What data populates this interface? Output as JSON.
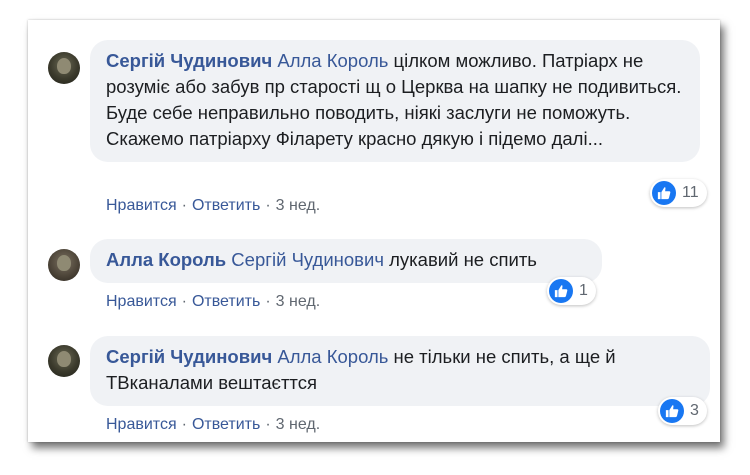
{
  "comments": [
    {
      "author": "Сергій Чудинович",
      "mention": "Алла Король",
      "text": "цілком можливо. Патріарх не розуміє або забув пр старості щ о Церква на шапку не подивиться. Буде себе неправильно поводить, ніякі заслуги не поможуть. Скажемо патріарху Філарету красно дякую і підемо далі...",
      "reaction_count": "11",
      "actions": {
        "like": "Нравится",
        "reply": "Ответить",
        "time": "3 нед."
      }
    },
    {
      "author": "Алла Король",
      "mention": "Сергій Чудинович",
      "text": "лукавий не спить",
      "reaction_count": "1",
      "actions": {
        "like": "Нравится",
        "reply": "Ответить",
        "time": "3 нед."
      }
    },
    {
      "author": "Сергій Чудинович",
      "mention": "Алла Король",
      "text": "не тільки не спить, а ще й ТВканалами вештаєттся",
      "reaction_count": "3",
      "actions": {
        "like": "Нравится",
        "reply": "Ответить",
        "time": "3 нед."
      }
    }
  ],
  "colors": {
    "link": "#385898",
    "bubble": "#f0f2f5",
    "like": "#1877f2",
    "meta": "#606770"
  },
  "icons": {
    "reaction": "thumbs-up-icon",
    "avatar": "avatar"
  }
}
